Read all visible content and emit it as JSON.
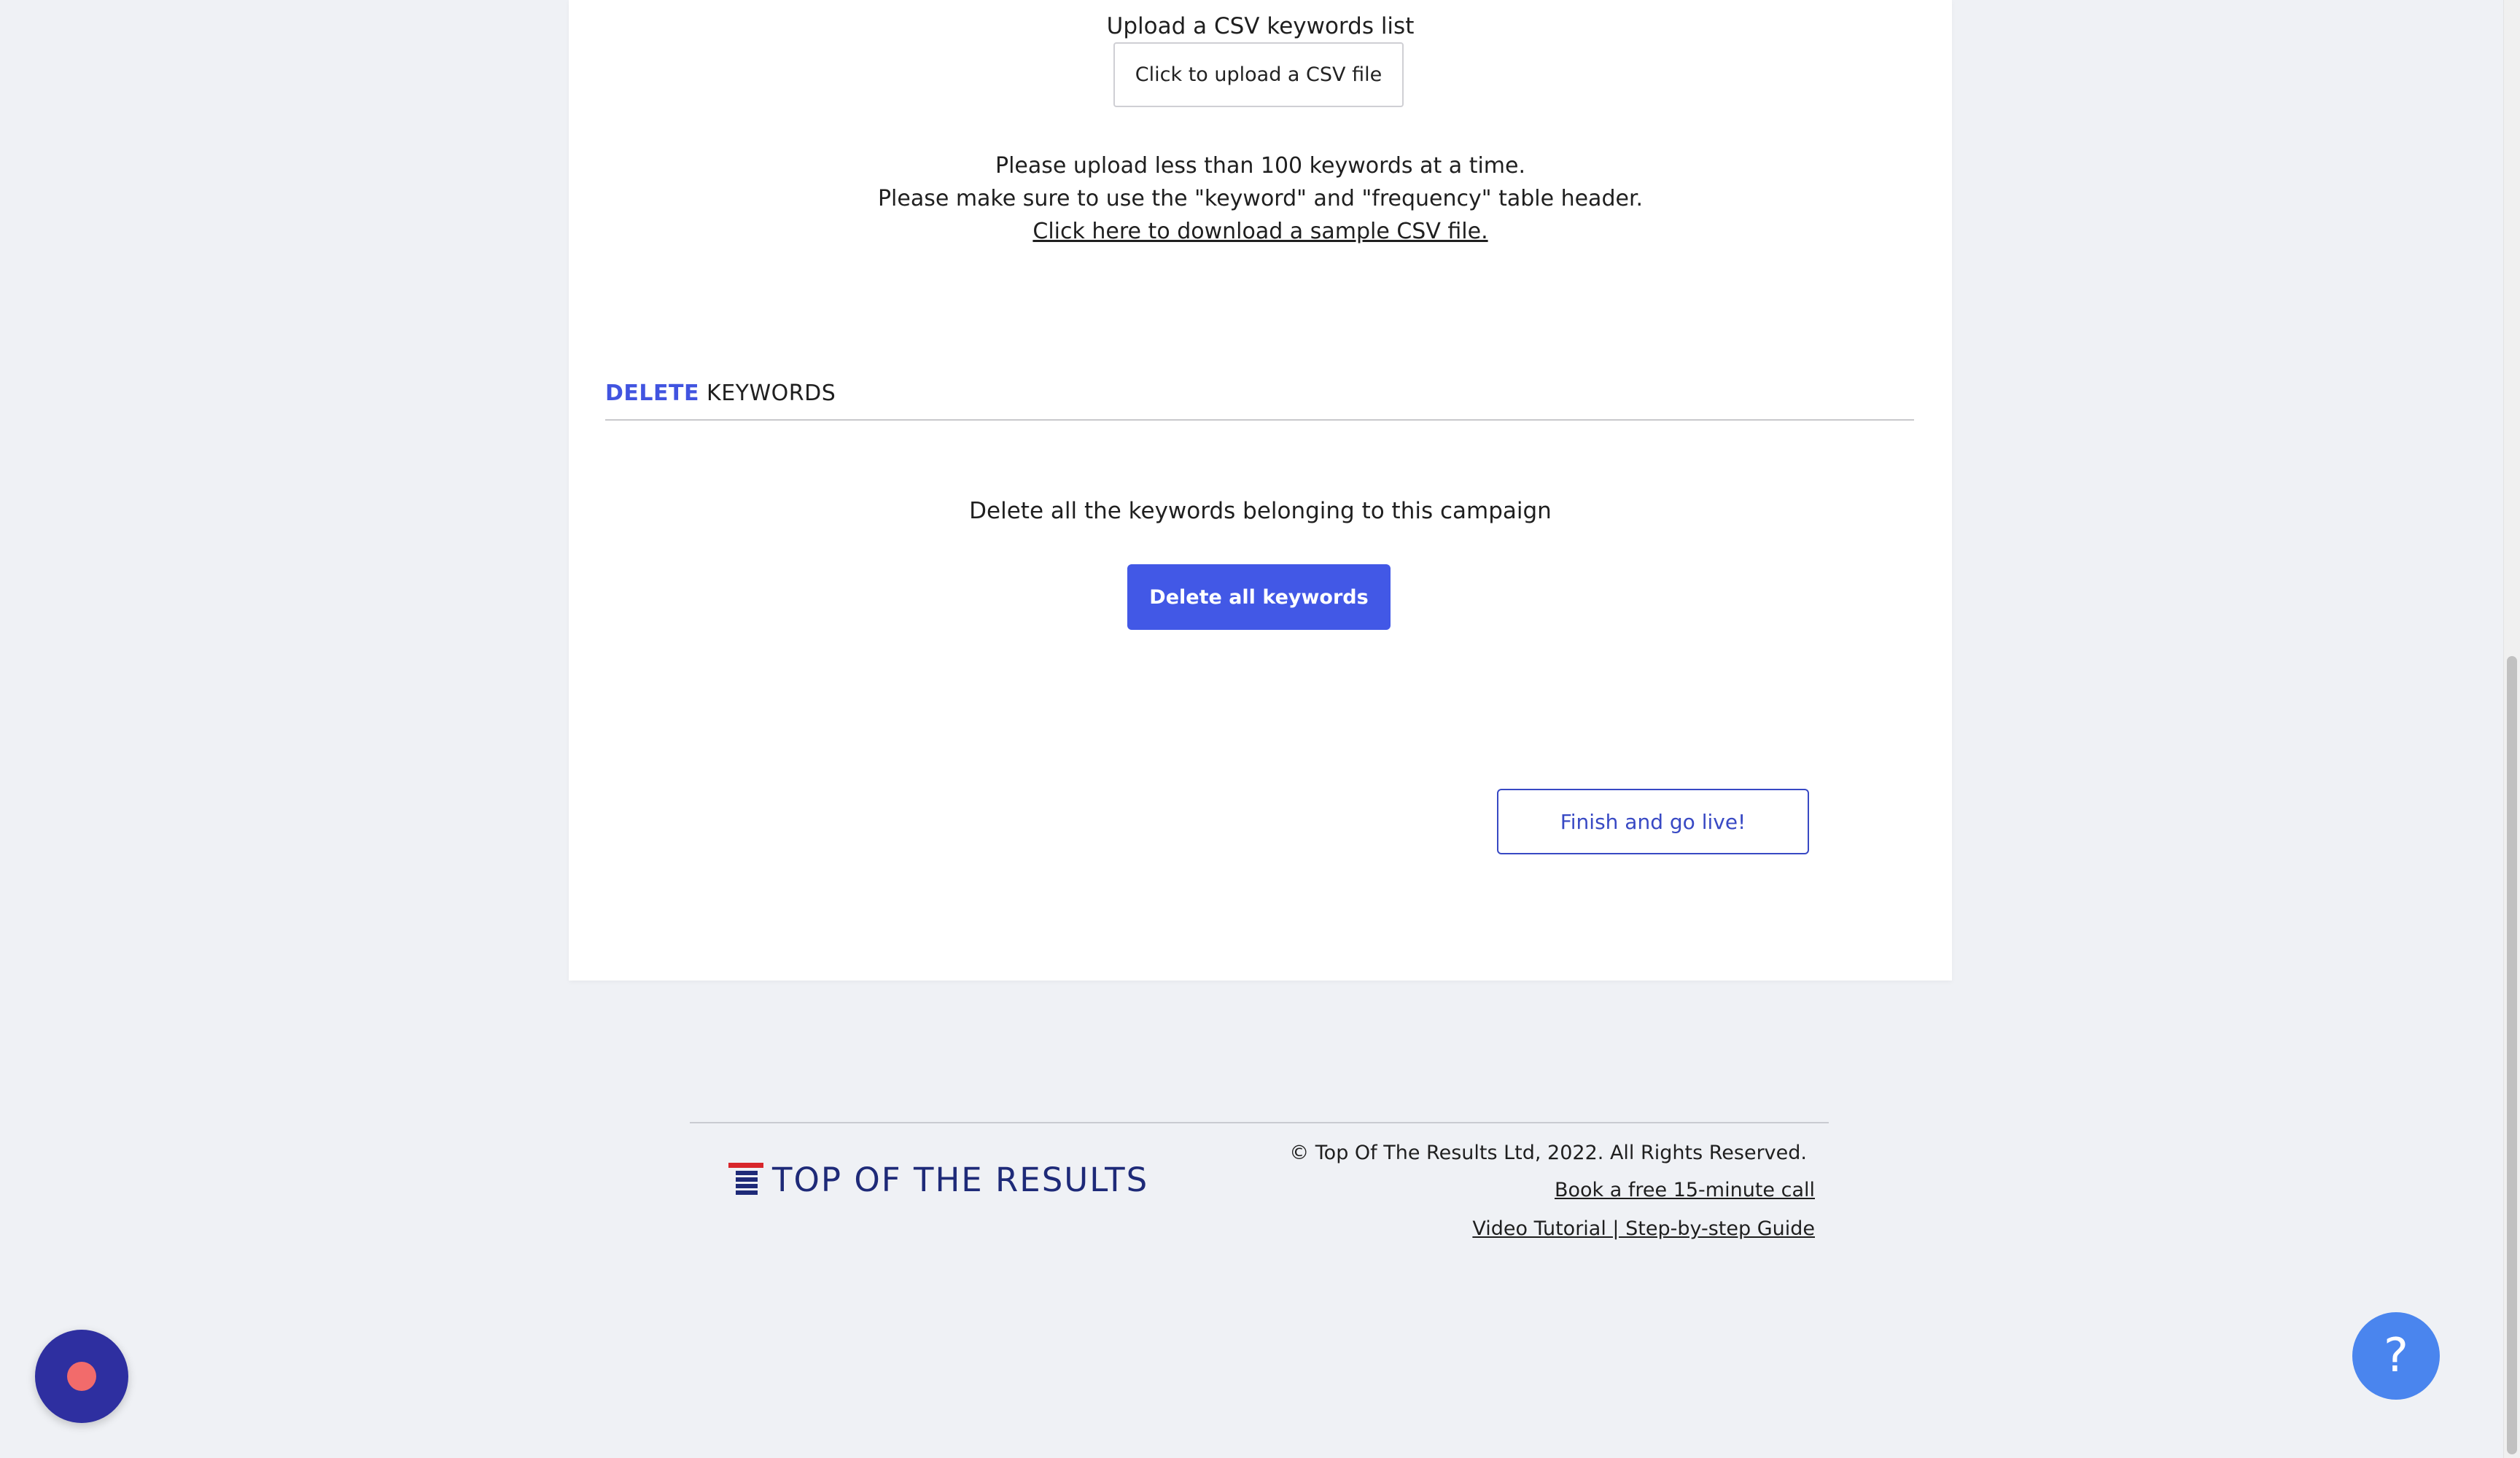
{
  "upload": {
    "title": "Upload a CSV keywords list",
    "button_label": "Click to upload a CSV file",
    "note_line1": "Please upload less than 100 keywords at a time.",
    "note_line2": "Please make sure to use the \"keyword\" and \"frequency\" table header.",
    "sample_link": "Click here to download a sample CSV file."
  },
  "delete_section": {
    "heading_accent": "DELETE",
    "heading_rest": "KEYWORDS",
    "description": "Delete all the keywords belonging to this campaign",
    "button_label": "Delete all keywords"
  },
  "finish_button_label": "Finish and go live!",
  "footer": {
    "logo_text": "TOP OF THE RESULTS",
    "copyright": "© Top Of The Results Ltd, 2022. All Rights Reserved.",
    "book_call_link": "Book a free 15-minute call",
    "guide_link": "Video Tutorial | Step-by-step Guide"
  },
  "help_widget_label": "?",
  "colors": {
    "accent": "#4258e6",
    "logo_red": "#d8262b",
    "logo_navy": "#1e2a78",
    "record_widget": "#2e2fa0",
    "help_widget": "#4a85ee"
  }
}
